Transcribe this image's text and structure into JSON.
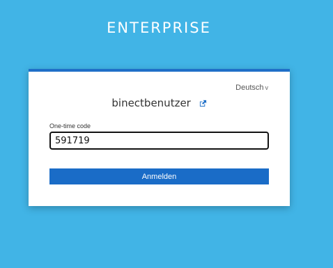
{
  "brand": {
    "title": "ENTERPRISE"
  },
  "card": {
    "language_selector": {
      "label": "Deutsch",
      "icon": "chevron-down-icon"
    },
    "username": "binectbenutzer",
    "username_action_icon": "external-link-icon",
    "otp": {
      "label": "One-time code",
      "value": "591719",
      "placeholder": ""
    },
    "submit_label": "Anmelden"
  },
  "colors": {
    "background": "#41b4e6",
    "card_accent": "#1f6fc8",
    "button": "#1a6cc7",
    "icon": "#1f6fc8"
  }
}
